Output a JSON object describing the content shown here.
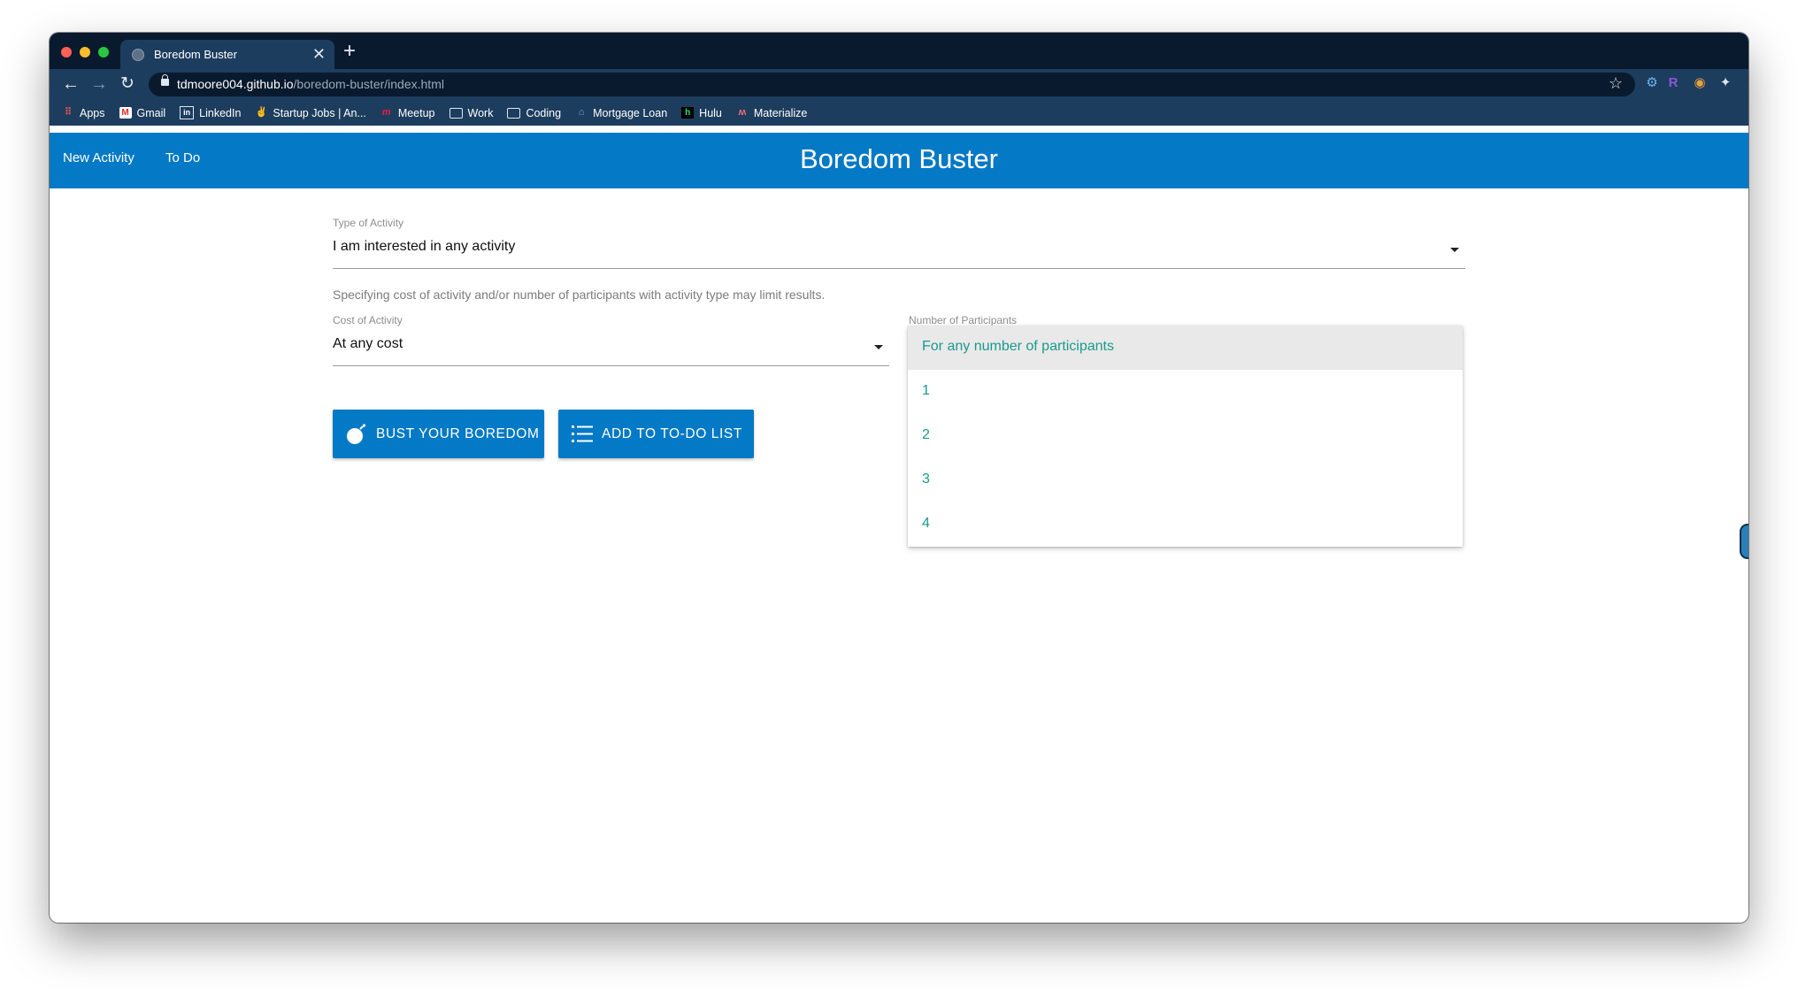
{
  "browser": {
    "tab_title": "Boredom Buster",
    "url_host": "tdmoore004.github.io",
    "url_path": "/boredom-buster/index.html",
    "bookmarks": [
      "Apps",
      "Gmail",
      "LinkedIn",
      "Startup Jobs | An...",
      "Meetup",
      "Work",
      "Coding",
      "Mortgage Loan",
      "Hulu",
      "Materialize"
    ]
  },
  "nav": {
    "links": [
      "New Activity",
      "To Do"
    ],
    "brand": "Boredom Buster"
  },
  "form": {
    "type_label": "Type of Activity",
    "type_value": "I am interested in any activity",
    "helper": "Specifying cost of activity and/or number of participants with activity type may limit results.",
    "cost_label": "Cost of Activity",
    "cost_value": "At any cost",
    "participants_label": "Number of Participants",
    "participants_options": [
      "For any number of participants",
      "1",
      "2",
      "3",
      "4"
    ],
    "participants_selected": "For any number of participants"
  },
  "buttons": {
    "bust": "BUST YOUR BOREDOM",
    "add": "ADD TO TO-DO LIST"
  },
  "colors": {
    "primary": "#0479c6",
    "option_text": "#1a9a8c",
    "chrome_dark": "#0a1a2e",
    "chrome": "#1d3d5e"
  }
}
